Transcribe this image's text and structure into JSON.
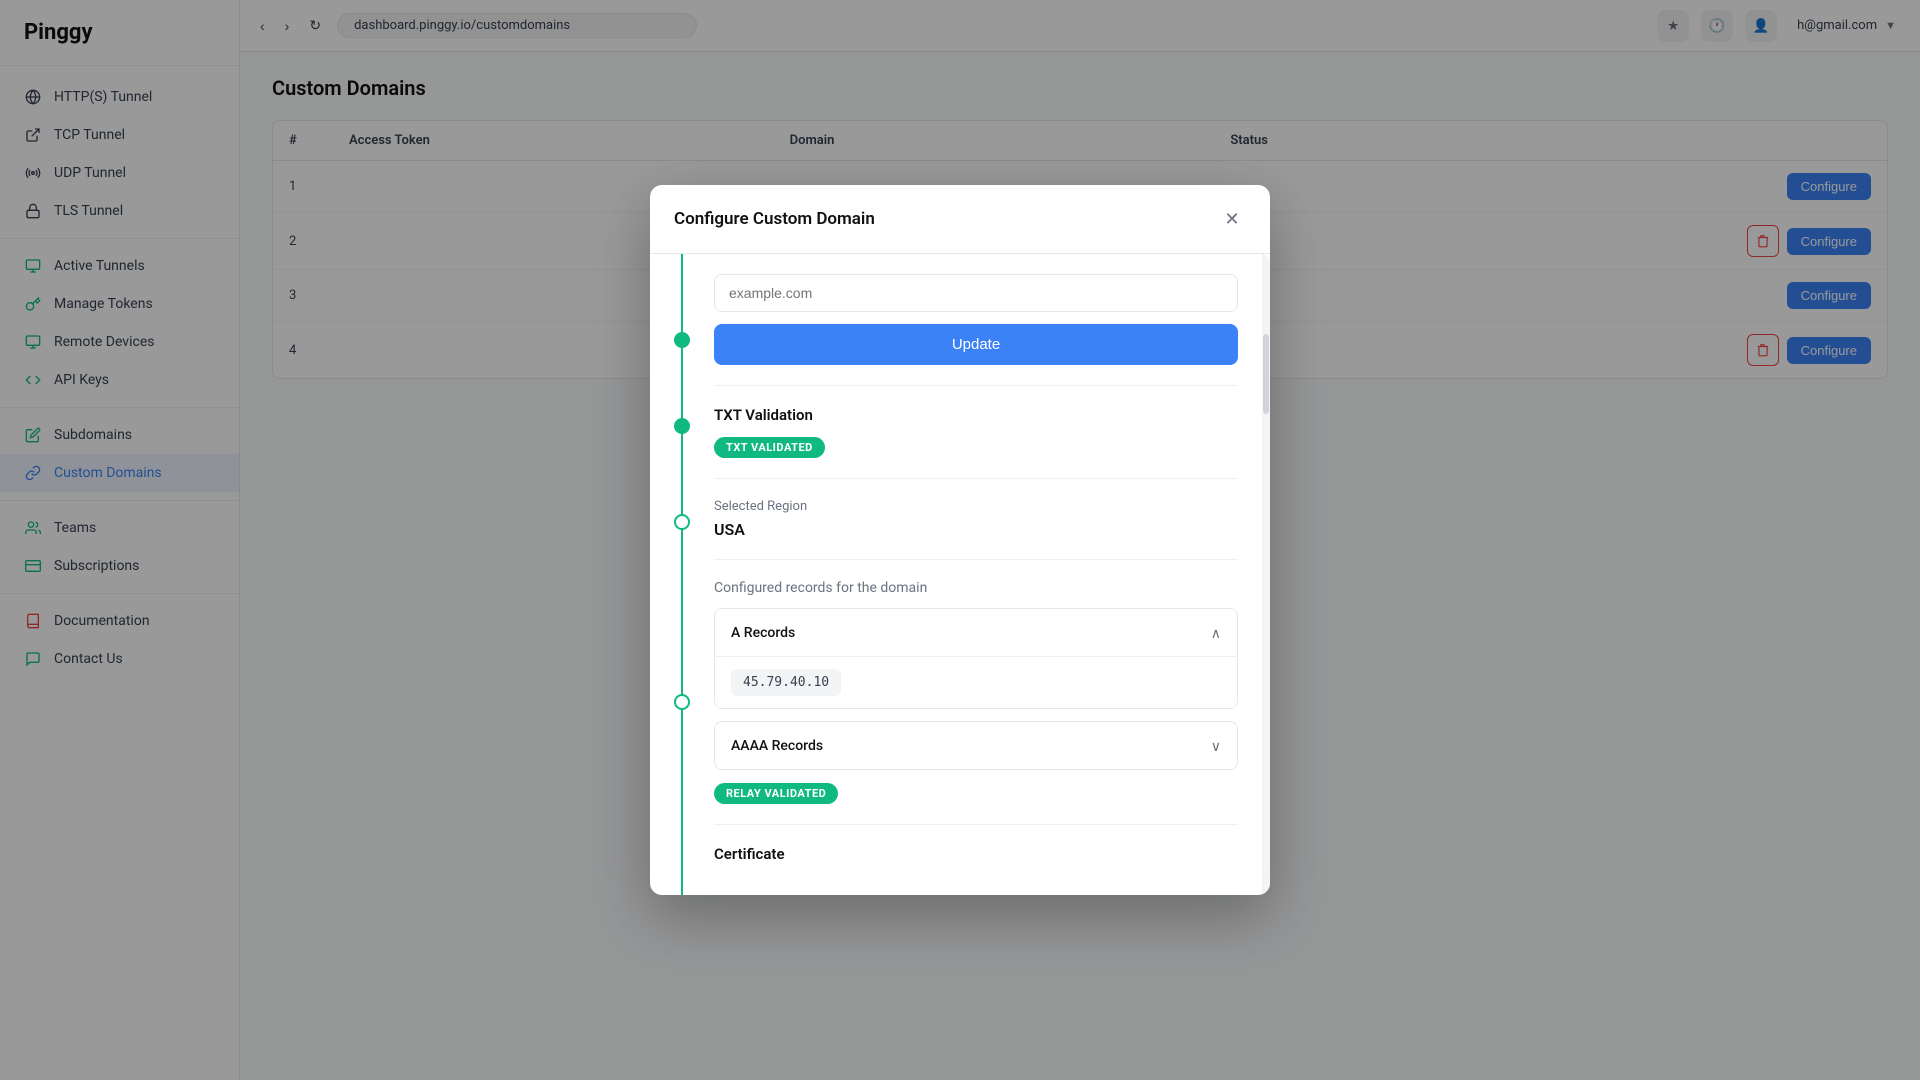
{
  "app": {
    "title": "Pinggy"
  },
  "topbar": {
    "url": "dashboard.pinggy.io/customdomains",
    "user_email": "h@gmail.com"
  },
  "sidebar": {
    "items": [
      {
        "id": "http-tunnel",
        "label": "HTTP(S) Tunnel",
        "icon": "globe"
      },
      {
        "id": "tcp-tunnel",
        "label": "TCP Tunnel",
        "icon": "plug"
      },
      {
        "id": "udp-tunnel",
        "label": "UDP Tunnel",
        "icon": "radio"
      },
      {
        "id": "tls-tunnel",
        "label": "TLS Tunnel",
        "icon": "lock"
      },
      {
        "id": "active-tunnels",
        "label": "Active Tunnels",
        "icon": "activity"
      },
      {
        "id": "manage-tokens",
        "label": "Manage Tokens",
        "icon": "key"
      },
      {
        "id": "remote-devices",
        "label": "Remote Devices",
        "icon": "monitor"
      },
      {
        "id": "api-keys",
        "label": "API Keys",
        "icon": "code"
      },
      {
        "id": "subdomains",
        "label": "Subdomains",
        "icon": "edit"
      },
      {
        "id": "custom-domains",
        "label": "Custom Domains",
        "icon": "link",
        "active": true
      },
      {
        "id": "teams",
        "label": "Teams",
        "icon": "users"
      },
      {
        "id": "subscriptions",
        "label": "Subscriptions",
        "icon": "credit-card"
      },
      {
        "id": "documentation",
        "label": "Documentation",
        "icon": "book"
      },
      {
        "id": "contact-us",
        "label": "Contact Us",
        "icon": "message"
      }
    ]
  },
  "page": {
    "title": "Custom Domains"
  },
  "table": {
    "columns": [
      "#",
      "Access Token",
      "Domain",
      "Status",
      ""
    ],
    "rows": [
      {
        "num": "1",
        "token": "",
        "domain": "",
        "status": ""
      },
      {
        "num": "2",
        "token": "",
        "domain": "",
        "status": ""
      },
      {
        "num": "3",
        "token": "",
        "domain": "",
        "status": ""
      },
      {
        "num": "4",
        "token": "",
        "domain": "",
        "status": ""
      }
    ],
    "configure_label": "Configure",
    "delete_icon": "🗑"
  },
  "modal": {
    "title": "Configure Custom Domain",
    "input_placeholder": "example.com",
    "update_button": "Update",
    "sections": {
      "txt_validation": {
        "title": "TXT Validation",
        "badge": "TXT VALIDATED"
      },
      "selected_region": {
        "label": "Selected Region",
        "value": "USA"
      },
      "configured_records": {
        "title": "Configured records for the domain",
        "a_records": {
          "title": "A Records",
          "expanded": true,
          "ip": "45.79.40.10"
        },
        "aaaa_records": {
          "title": "AAAA Records",
          "expanded": false,
          "badge": "RELAY VALIDATED"
        }
      },
      "certificate": {
        "title": "Certificate"
      }
    }
  }
}
